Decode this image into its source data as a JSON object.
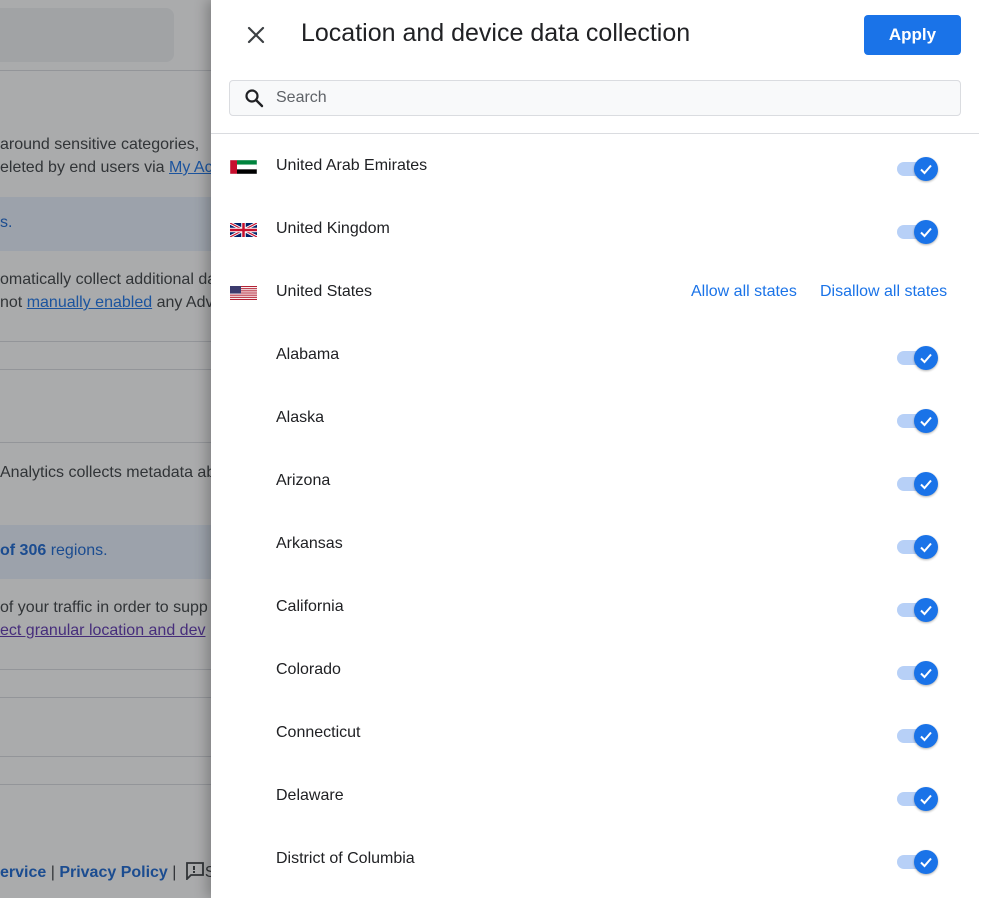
{
  "background": {
    "text_lines": [
      "around sensitive categories,",
      "eleted by end users via",
      "omatically collect additional da",
      "not",
      "Analytics collects metadata ab",
      "of your traffic in order to supp",
      "ect granular location and dev"
    ],
    "links": {
      "my_activity": "My Ac",
      "manually_enabled": "manually enabled",
      "after_link": " any Adv"
    },
    "band1_text": "s.",
    "band2_bold": "of 306",
    "band2_rest": " regions.",
    "footer": {
      "terms": "ervice",
      "sep1": " | ",
      "privacy": "Privacy Policy",
      "sep2": " | ",
      "feedback_tail": "S"
    }
  },
  "drawer": {
    "title": "Location and device data collection",
    "apply_label": "Apply",
    "search_placeholder": "Search",
    "countries": [
      {
        "name": "United Arab Emirates",
        "flag": "uae-flag-icon",
        "enabled": true
      },
      {
        "name": "United Kingdom",
        "flag": "uk-flag-icon",
        "enabled": true
      }
    ],
    "us": {
      "name": "United States",
      "flag": "us-flag-icon",
      "allow_all": "Allow all states",
      "disallow_all": "Disallow all states"
    },
    "states": [
      {
        "name": "Alabama",
        "enabled": true
      },
      {
        "name": "Alaska",
        "enabled": true
      },
      {
        "name": "Arizona",
        "enabled": true
      },
      {
        "name": "Arkansas",
        "enabled": true
      },
      {
        "name": "California",
        "enabled": true
      },
      {
        "name": "Colorado",
        "enabled": true
      },
      {
        "name": "Connecticut",
        "enabled": true
      },
      {
        "name": "Delaware",
        "enabled": true
      },
      {
        "name": "District of Columbia",
        "enabled": true
      }
    ]
  },
  "colors": {
    "accent": "#1a73e8",
    "toggle_track": "#b7d0f7"
  }
}
